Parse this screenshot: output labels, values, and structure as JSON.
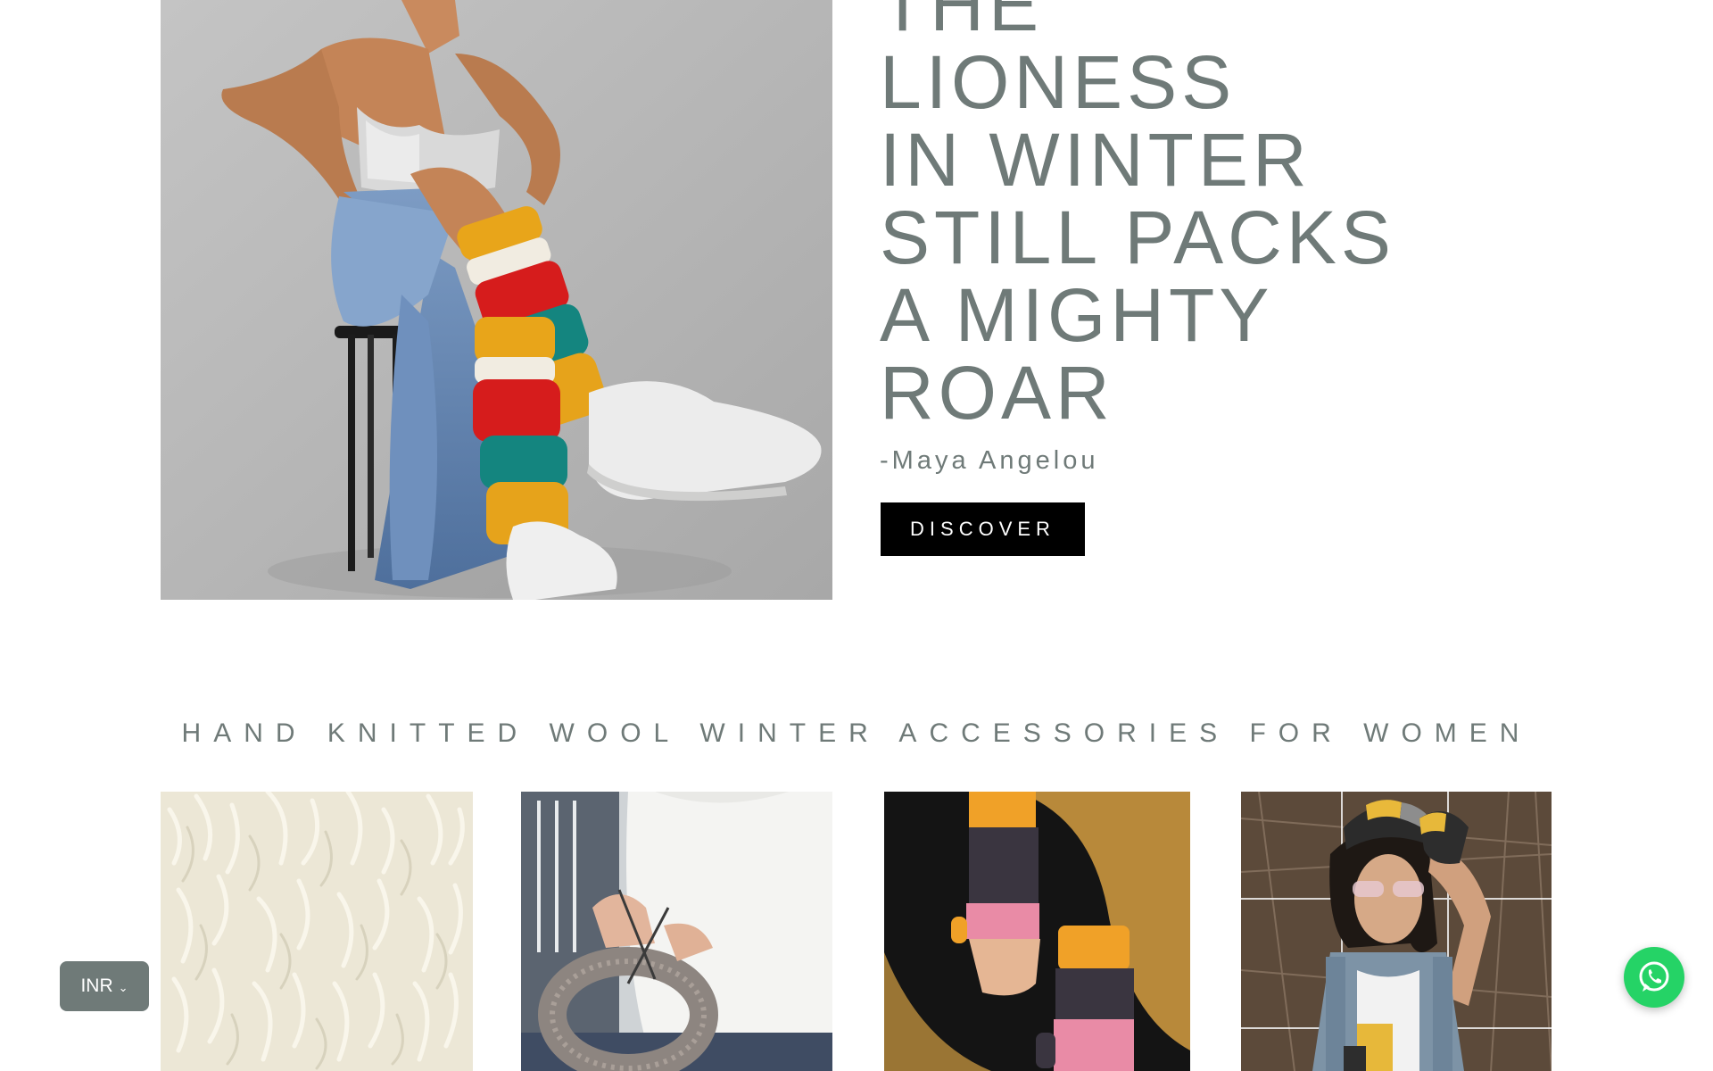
{
  "hero": {
    "quote_lines": [
      "THE",
      "LIONESS",
      "IN WINTER",
      "STILL PACKS",
      "A MIGHTY",
      "ROAR"
    ],
    "author": "-Maya Angelou",
    "cta_label": "DISCOVER"
  },
  "section": {
    "title": "HAND KNITTED WOOL WINTER ACCESSORIES FOR WOMEN"
  },
  "currency": {
    "selected": "INR",
    "chevron": "⌄"
  },
  "icons": {
    "whatsapp": "whatsapp-icon"
  },
  "colors": {
    "text_muted": "#6f7a78",
    "button_bg": "#000000",
    "currency_bg": "#6f7a78",
    "whatsapp_bg": "#25d366"
  }
}
